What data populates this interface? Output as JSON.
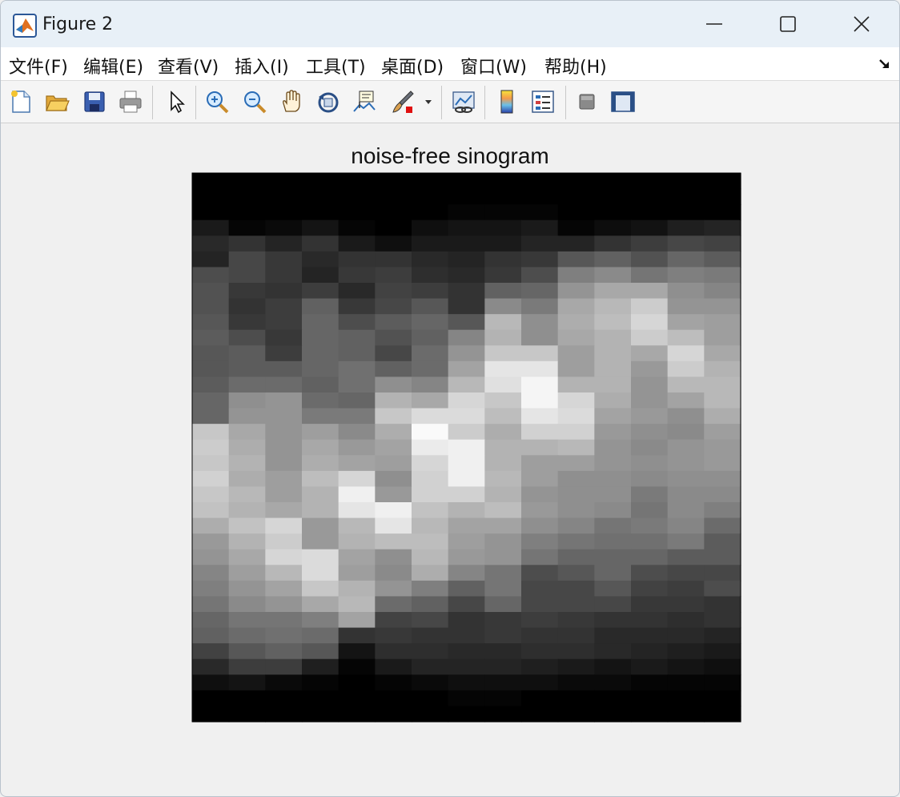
{
  "window": {
    "title": "Figure 2",
    "icon": "matlab-icon",
    "controls": [
      "minimize-icon",
      "maximize-icon",
      "close-icon"
    ]
  },
  "menubar": {
    "items": [
      {
        "label": "文件(F)"
      },
      {
        "label": "编辑(E)"
      },
      {
        "label": "查看(V)"
      },
      {
        "label": "插入(I)"
      },
      {
        "label": "工具(T)"
      },
      {
        "label": "桌面(D)"
      },
      {
        "label": "窗口(W)"
      },
      {
        "label": "帮助(H)"
      }
    ],
    "dock_icon": "dock-arrow-icon"
  },
  "toolbar": {
    "buttons": [
      "new-figure-icon",
      "open-file-icon",
      "save-icon",
      "print-icon",
      "select-pointer-icon",
      "zoom-in-icon",
      "zoom-out-icon",
      "pan-hand-icon",
      "rotate-3d-icon",
      "data-cursor-icon",
      "brush-icon",
      "brush-dropdown-icon",
      "link-plot-icon",
      "colorbar-icon",
      "legend-icon",
      "hide-plot-tools-icon",
      "show-plot-tools-icon"
    ]
  },
  "chart_data": {
    "type": "heatmap",
    "title": "noise-free sinogram",
    "colormap": "gray",
    "xlabel": "",
    "ylabel": "",
    "axes_visible": false,
    "columns": 15,
    "rows": 27,
    "values": [
      [
        0,
        0,
        0,
        0,
        0,
        0,
        0,
        0,
        0,
        0,
        0,
        0,
        0,
        0,
        0
      ],
      [
        0,
        0,
        0,
        0,
        0,
        0,
        0,
        0,
        0,
        0,
        0,
        0,
        0,
        0,
        0
      ],
      [
        0,
        0,
        0,
        0,
        0,
        0,
        0,
        2,
        2,
        2,
        0,
        0,
        0,
        0,
        0
      ],
      [
        10,
        2,
        4,
        8,
        2,
        0,
        6,
        8,
        8,
        10,
        2,
        5,
        7,
        12,
        14
      ],
      [
        16,
        20,
        14,
        20,
        10,
        6,
        10,
        10,
        10,
        14,
        14,
        20,
        24,
        28,
        26
      ],
      [
        14,
        28,
        22,
        16,
        20,
        20,
        16,
        14,
        20,
        22,
        34,
        38,
        32,
        40,
        36
      ],
      [
        30,
        28,
        22,
        14,
        22,
        24,
        18,
        16,
        22,
        30,
        50,
        54,
        46,
        50,
        48
      ],
      [
        32,
        22,
        20,
        24,
        16,
        26,
        24,
        20,
        38,
        40,
        58,
        66,
        66,
        56,
        52
      ],
      [
        32,
        20,
        24,
        38,
        22,
        28,
        34,
        20,
        54,
        48,
        66,
        72,
        80,
        58,
        58
      ],
      [
        34,
        22,
        24,
        40,
        30,
        36,
        40,
        34,
        72,
        56,
        68,
        74,
        84,
        64,
        62
      ],
      [
        36,
        30,
        22,
        40,
        38,
        32,
        38,
        52,
        70,
        56,
        66,
        70,
        80,
        74,
        62
      ],
      [
        34,
        36,
        24,
        40,
        38,
        28,
        42,
        58,
        78,
        78,
        62,
        70,
        66,
        84,
        66
      ],
      [
        34,
        36,
        36,
        40,
        44,
        38,
        42,
        64,
        90,
        90,
        62,
        70,
        60,
        80,
        70
      ],
      [
        36,
        42,
        42,
        38,
        44,
        56,
        52,
        72,
        88,
        96,
        70,
        70,
        58,
        72,
        72
      ],
      [
        40,
        56,
        58,
        42,
        40,
        70,
        66,
        84,
        78,
        96,
        84,
        68,
        58,
        64,
        72
      ],
      [
        40,
        58,
        58,
        48,
        48,
        78,
        86,
        86,
        74,
        90,
        86,
        64,
        60,
        56,
        68
      ],
      [
        78,
        66,
        58,
        62,
        54,
        68,
        98,
        80,
        68,
        82,
        82,
        60,
        56,
        54,
        62
      ],
      [
        80,
        68,
        58,
        66,
        60,
        64,
        92,
        94,
        70,
        70,
        72,
        58,
        54,
        58,
        60
      ],
      [
        78,
        70,
        58,
        68,
        64,
        62,
        84,
        94,
        70,
        62,
        62,
        58,
        56,
        58,
        60
      ],
      [
        82,
        68,
        62,
        74,
        84,
        56,
        82,
        94,
        72,
        62,
        56,
        56,
        54,
        56,
        56
      ],
      [
        78,
        72,
        62,
        70,
        94,
        60,
        82,
        82,
        70,
        58,
        56,
        56,
        48,
        54,
        54
      ],
      [
        76,
        70,
        66,
        70,
        90,
        94,
        76,
        70,
        74,
        60,
        56,
        54,
        46,
        54,
        50
      ],
      [
        68,
        76,
        84,
        60,
        72,
        90,
        72,
        64,
        64,
        56,
        52,
        46,
        48,
        52,
        42
      ],
      [
        60,
        70,
        80,
        60,
        70,
        74,
        74,
        62,
        58,
        50,
        46,
        44,
        44,
        48,
        36
      ],
      [
        58,
        66,
        84,
        86,
        64,
        56,
        72,
        60,
        58,
        46,
        40,
        40,
        40,
        36,
        36
      ],
      [
        52,
        62,
        72,
        86,
        62,
        54,
        68,
        52,
        46,
        30,
        34,
        40,
        30,
        28,
        28
      ],
      [
        50,
        58,
        64,
        78,
        70,
        58,
        50,
        38,
        46,
        28,
        28,
        34,
        26,
        24,
        30
      ],
      [
        46,
        54,
        58,
        66,
        72,
        42,
        38,
        28,
        40,
        28,
        28,
        28,
        22,
        22,
        20
      ],
      [
        40,
        46,
        46,
        50,
        64,
        26,
        28,
        20,
        22,
        24,
        22,
        20,
        20,
        18,
        20
      ],
      [
        38,
        42,
        44,
        42,
        20,
        22,
        20,
        20,
        22,
        20,
        20,
        16,
        16,
        16,
        14
      ],
      [
        26,
        34,
        38,
        34,
        8,
        18,
        18,
        16,
        16,
        18,
        18,
        16,
        14,
        12,
        10
      ],
      [
        16,
        24,
        24,
        12,
        2,
        10,
        14,
        14,
        14,
        12,
        10,
        8,
        10,
        8,
        6
      ],
      [
        6,
        8,
        4,
        2,
        0,
        2,
        4,
        6,
        6,
        6,
        4,
        4,
        2,
        2,
        2
      ],
      [
        0,
        0,
        0,
        0,
        0,
        0,
        0,
        2,
        2,
        0,
        0,
        0,
        0,
        0,
        0
      ],
      [
        0,
        0,
        0,
        0,
        0,
        0,
        0,
        0,
        0,
        0,
        0,
        0,
        0,
        0,
        0
      ]
    ]
  }
}
